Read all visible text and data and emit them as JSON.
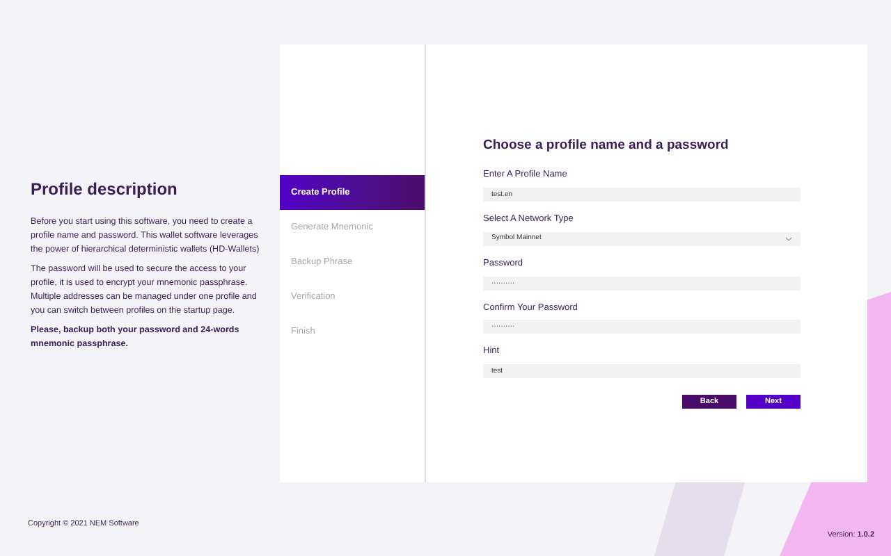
{
  "description": {
    "title": "Profile description",
    "paragraphs": [
      "Before you start using this software, you need to create a profile name and password. This wallet software leverages the power of hierarchical deterministic wallets (HD-Wallets)",
      "The password will be used to secure the access to your profile, it is used to encrypt your mnemonic passphrase. Multiple addresses can be managed under one profile and you can switch between profiles on the startup page."
    ],
    "note": "Please, backup both your password and 24-words mnemonic passphrase."
  },
  "steps": [
    {
      "label": "Create Profile",
      "selected": true
    },
    {
      "label": "Generate Mnemonic",
      "selected": false
    },
    {
      "label": "Backup Phrase",
      "selected": false
    },
    {
      "label": "Verification",
      "selected": false
    },
    {
      "label": "Finish",
      "selected": false
    }
  ],
  "form": {
    "title": "Choose a profile name and a password",
    "fields": [
      {
        "kind": "text",
        "label": "Enter A Profile Name",
        "value": "test.en"
      },
      {
        "kind": "select",
        "label": "Select A Network Type",
        "value": "Symbol Mainnet"
      },
      {
        "kind": "text",
        "label": "Password",
        "value": "··········"
      },
      {
        "kind": "text",
        "label": "Confirm Your Password",
        "value": "··········"
      },
      {
        "kind": "text",
        "label": "Hint",
        "value": "test"
      }
    ],
    "buttons": [
      {
        "kind": "secondary",
        "label": "Back"
      },
      {
        "kind": "primary",
        "label": "Next"
      }
    ]
  },
  "footer": {
    "copyright": "Copyright © 2021 NEM Software",
    "version": "Version: **1.0.2**"
  }
}
